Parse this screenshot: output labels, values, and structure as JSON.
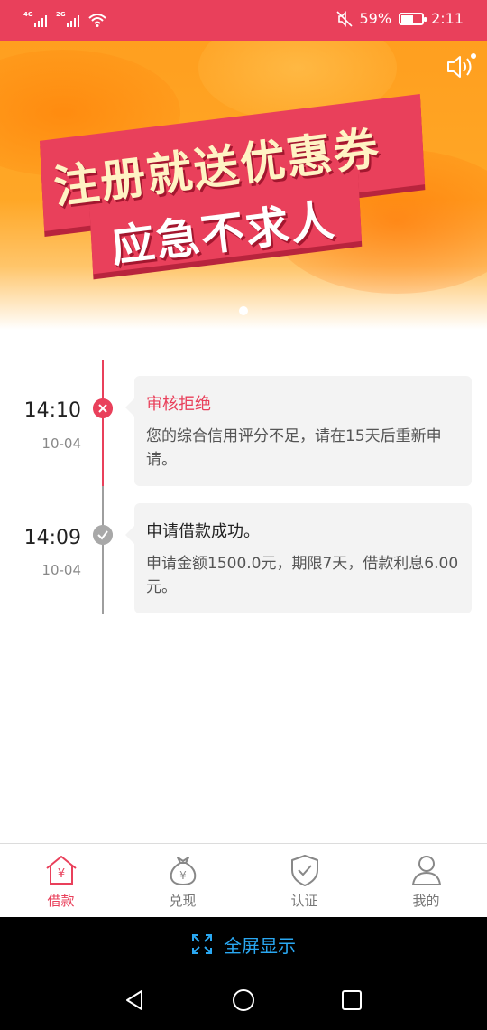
{
  "status_bar": {
    "network_1": "4G",
    "network_2": "2G",
    "battery_percent": "59%",
    "battery_level": 0.59,
    "time": "2:11",
    "icons": [
      "signal-icon",
      "signal-icon",
      "wifi-icon",
      "mute-icon",
      "battery-icon"
    ]
  },
  "banner": {
    "headline": "注册就送优惠券",
    "subheadline": "应急不求人",
    "page_index": 1
  },
  "timeline": [
    {
      "time": "14:10",
      "date": "10-04",
      "status": "reject",
      "title": "审核拒绝",
      "body": "您的综合信用评分不足，请在15天后重新申请。"
    },
    {
      "time": "14:09",
      "date": "10-04",
      "status": "success",
      "title": "申请借款成功。",
      "body": "申请金额1500.0元，期限7天，借款利息6.00元。"
    }
  ],
  "bottom_nav": {
    "items": [
      {
        "label": "借款",
        "icon": "loan-house-icon",
        "active": true
      },
      {
        "label": "兑现",
        "icon": "money-bag-icon",
        "active": false
      },
      {
        "label": "认证",
        "icon": "shield-check-icon",
        "active": false
      },
      {
        "label": "我的",
        "icon": "user-icon",
        "active": false
      }
    ]
  },
  "fullscreen": {
    "label": "全屏显示",
    "icon": "expand-icon"
  },
  "colors": {
    "accent": "#e9405b",
    "inactive": "#777777",
    "link_blue": "#2aa8f2"
  }
}
